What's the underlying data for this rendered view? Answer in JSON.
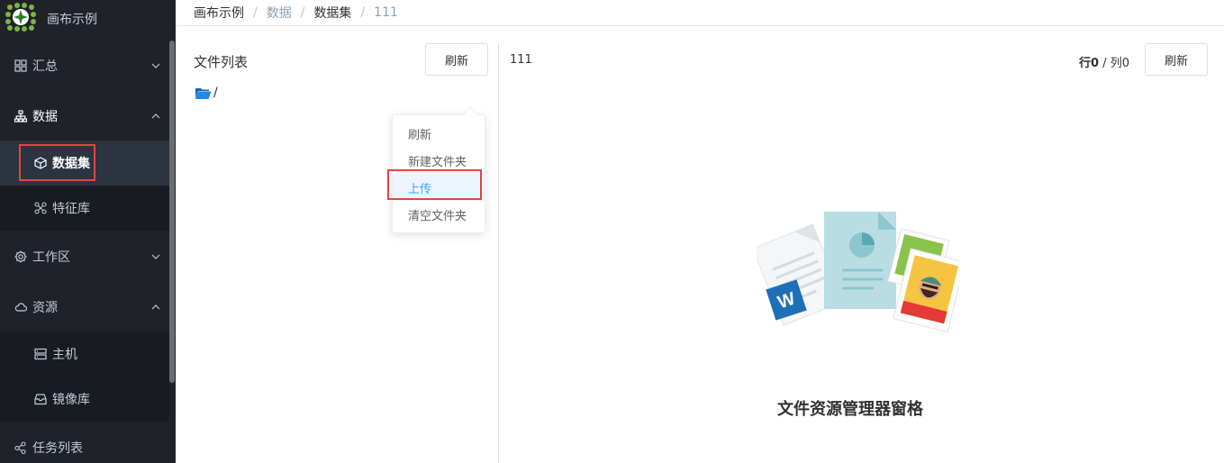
{
  "app": {
    "name": "画布示例"
  },
  "sidebar": {
    "items": [
      {
        "label": "汇总",
        "icon": "grid-icon",
        "expanded": false
      },
      {
        "label": "数据",
        "icon": "sitemap-icon",
        "expanded": true,
        "children": [
          {
            "label": "数据集",
            "icon": "cube-icon",
            "active": true
          },
          {
            "label": "特征库",
            "icon": "nodes-icon"
          }
        ]
      },
      {
        "label": "工作区",
        "icon": "gear-icon",
        "expanded": false
      },
      {
        "label": "资源",
        "icon": "cloud-icon",
        "expanded": true,
        "children": [
          {
            "label": "主机",
            "icon": "server-icon"
          },
          {
            "label": "镜像库",
            "icon": "archive-icon"
          }
        ]
      },
      {
        "label": "任务列表",
        "icon": "share-icon"
      }
    ]
  },
  "breadcrumb": [
    "画布示例",
    "数据",
    "数据集",
    "111"
  ],
  "file_panel": {
    "title": "文件列表",
    "refresh_label": "刷新",
    "root_path": "/"
  },
  "context_menu": {
    "items": [
      "刷新",
      "新建文件夹",
      "上传",
      "清空文件夹"
    ],
    "hovered": "上传"
  },
  "preview": {
    "file_name": "111",
    "row_label": "行",
    "row_count": "0",
    "separator": " / ",
    "col_label": "列",
    "col_count": "0",
    "refresh_label": "刷新",
    "empty_caption": "文件资源管理器窗格"
  },
  "colors": {
    "sidebar_bg": "#1f2229",
    "accent": "#409eff",
    "highlight": "#e24545"
  }
}
